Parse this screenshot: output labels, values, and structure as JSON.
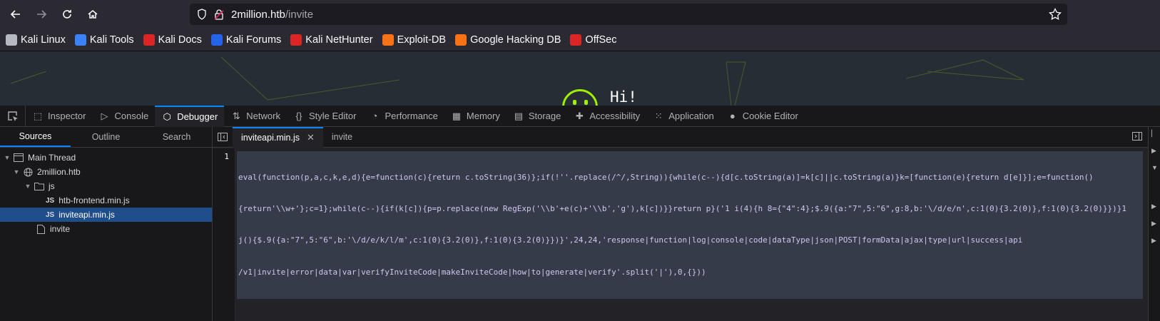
{
  "browser": {
    "url_host": "2million.htb",
    "url_path": "/invite"
  },
  "bookmarks": [
    {
      "label": "Kali Linux",
      "icon": "kali-dragon-icon",
      "color": "#b8b8c0"
    },
    {
      "label": "Kali Tools",
      "icon": "kali-tools-icon",
      "color": "#3b82f6"
    },
    {
      "label": "Kali Docs",
      "icon": "kali-docs-icon",
      "color": "#dc2626"
    },
    {
      "label": "Kali Forums",
      "icon": "kali-forums-icon",
      "color": "#2563eb"
    },
    {
      "label": "Kali NetHunter",
      "icon": "kali-nethunter-icon",
      "color": "#dc2626"
    },
    {
      "label": "Exploit-DB",
      "icon": "exploit-db-icon",
      "color": "#f97316"
    },
    {
      "label": "Google Hacking DB",
      "icon": "ghdb-icon",
      "color": "#f97316"
    },
    {
      "label": "OffSec",
      "icon": "offsec-icon",
      "color": "#dc2626"
    }
  ],
  "page": {
    "greeting": "Hi!"
  },
  "devtools": {
    "tabs": [
      {
        "label": "Inspector",
        "icon": "inspector-icon",
        "glyph": "⬚"
      },
      {
        "label": "Console",
        "icon": "console-icon",
        "glyph": "▷"
      },
      {
        "label": "Debugger",
        "icon": "debugger-icon",
        "glyph": "⬡",
        "active": true
      },
      {
        "label": "Network",
        "icon": "network-icon",
        "glyph": "⇅"
      },
      {
        "label": "Style Editor",
        "icon": "style-editor-icon",
        "glyph": "{}"
      },
      {
        "label": "Performance",
        "icon": "performance-icon",
        "glyph": "◔"
      },
      {
        "label": "Memory",
        "icon": "memory-icon",
        "glyph": "▦"
      },
      {
        "label": "Storage",
        "icon": "storage-icon",
        "glyph": "▤"
      },
      {
        "label": "Accessibility",
        "icon": "accessibility-icon",
        "glyph": "✚"
      },
      {
        "label": "Application",
        "icon": "application-icon",
        "glyph": "⁙"
      },
      {
        "label": "Cookie Editor",
        "icon": "cookie-icon",
        "glyph": "●"
      }
    ],
    "sources_tabs": [
      "Sources",
      "Outline",
      "Search"
    ],
    "tree": {
      "thread": "Main Thread",
      "host": "2million.htb",
      "folder": "js",
      "files": [
        "htb-frontend.min.js",
        "inviteapi.min.js"
      ],
      "page": "invite",
      "js_badge": "JS"
    },
    "editor_tabs": [
      {
        "label": "inviteapi.min.js",
        "active": true
      },
      {
        "label": "invite",
        "active": false
      }
    ],
    "line_number": "1",
    "code_lines": [
      "eval(function(p,a,c,k,e,d){e=function(c){return c.toString(36)};if(!''.replace(/^/,String)){while(c--){d[c.toString(a)]=k[c]||c.toString(a)}k=[function(e){return d[e]}];e=function()",
      "{return'\\\\w+'};c=1};while(c--){if(k[c]){p=p.replace(new RegExp('\\\\b'+e(c)+'\\\\b','g'),k[c])}}return p}('1 i(4){h 8={\"4\":4};$.9({a:\"7\",5:\"6\",g:8,b:'\\/d/e/n',c:1(0){3.2(0)},f:1(0){3.2(0)}})}1",
      "j(){$.9({a:\"7\",5:\"6\",b:'\\/d/e/k/l/m',c:1(0){3.2(0)},f:1(0){3.2(0)}})}',24,24,'response|function|log|console|code|dataType|json|POST|formData|ajax|type|url|success|api",
      "/v1|invite|error|data|var|verifyInviteCode|makeInviteCode|how|to|generate|verify'.split('|'),0,{}))"
    ]
  }
}
